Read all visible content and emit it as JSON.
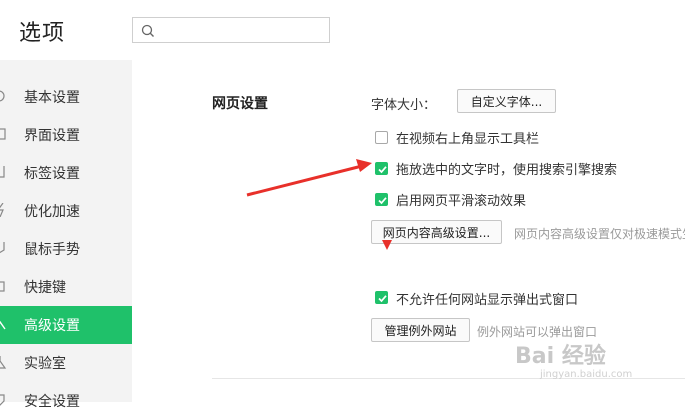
{
  "window": {
    "title": "选项"
  },
  "search": {
    "placeholder": ""
  },
  "sidebar": {
    "items": [
      {
        "label": "基本设置",
        "icon": "home-icon"
      },
      {
        "label": "界面设置",
        "icon": "window-icon"
      },
      {
        "label": "标签设置",
        "icon": "tab-icon"
      },
      {
        "label": "优化加速",
        "icon": "lightning-icon"
      },
      {
        "label": "鼠标手势",
        "icon": "mouse-icon"
      },
      {
        "label": "快捷键",
        "icon": "keyboard-icon"
      },
      {
        "label": "高级设置",
        "icon": "wrench-icon",
        "active": true
      },
      {
        "label": "实验室",
        "icon": "flask-icon"
      },
      {
        "label": "安全设置",
        "icon": "shield-icon"
      }
    ]
  },
  "webpage": {
    "section_title": "网页设置",
    "font_size_label": "字体大小：",
    "custom_font_button": "自定义字体...",
    "options": [
      {
        "label": "在视频右上角显示工具栏",
        "checked": false
      },
      {
        "label": "拖放选中的文字时，使用搜索引擎搜索",
        "checked": true
      },
      {
        "label": "启用网页平滑滚动效果",
        "checked": true
      }
    ],
    "advanced_button": "网页内容高级设置...",
    "advanced_hint": "网页内容高级设置仅对极速模式生效",
    "popup_option": {
      "label": "不允许任何网站显示弹出式窗口",
      "checked": true
    },
    "manage_exceptions_button": "管理例外网站",
    "exceptions_hint": "例外网站可以弹出窗口"
  },
  "watermark": {
    "brand": "Bai 经验",
    "url": "jingyan.baidu.com"
  },
  "colors": {
    "accent": "#1fc16a",
    "annotation": "#e8302a"
  }
}
